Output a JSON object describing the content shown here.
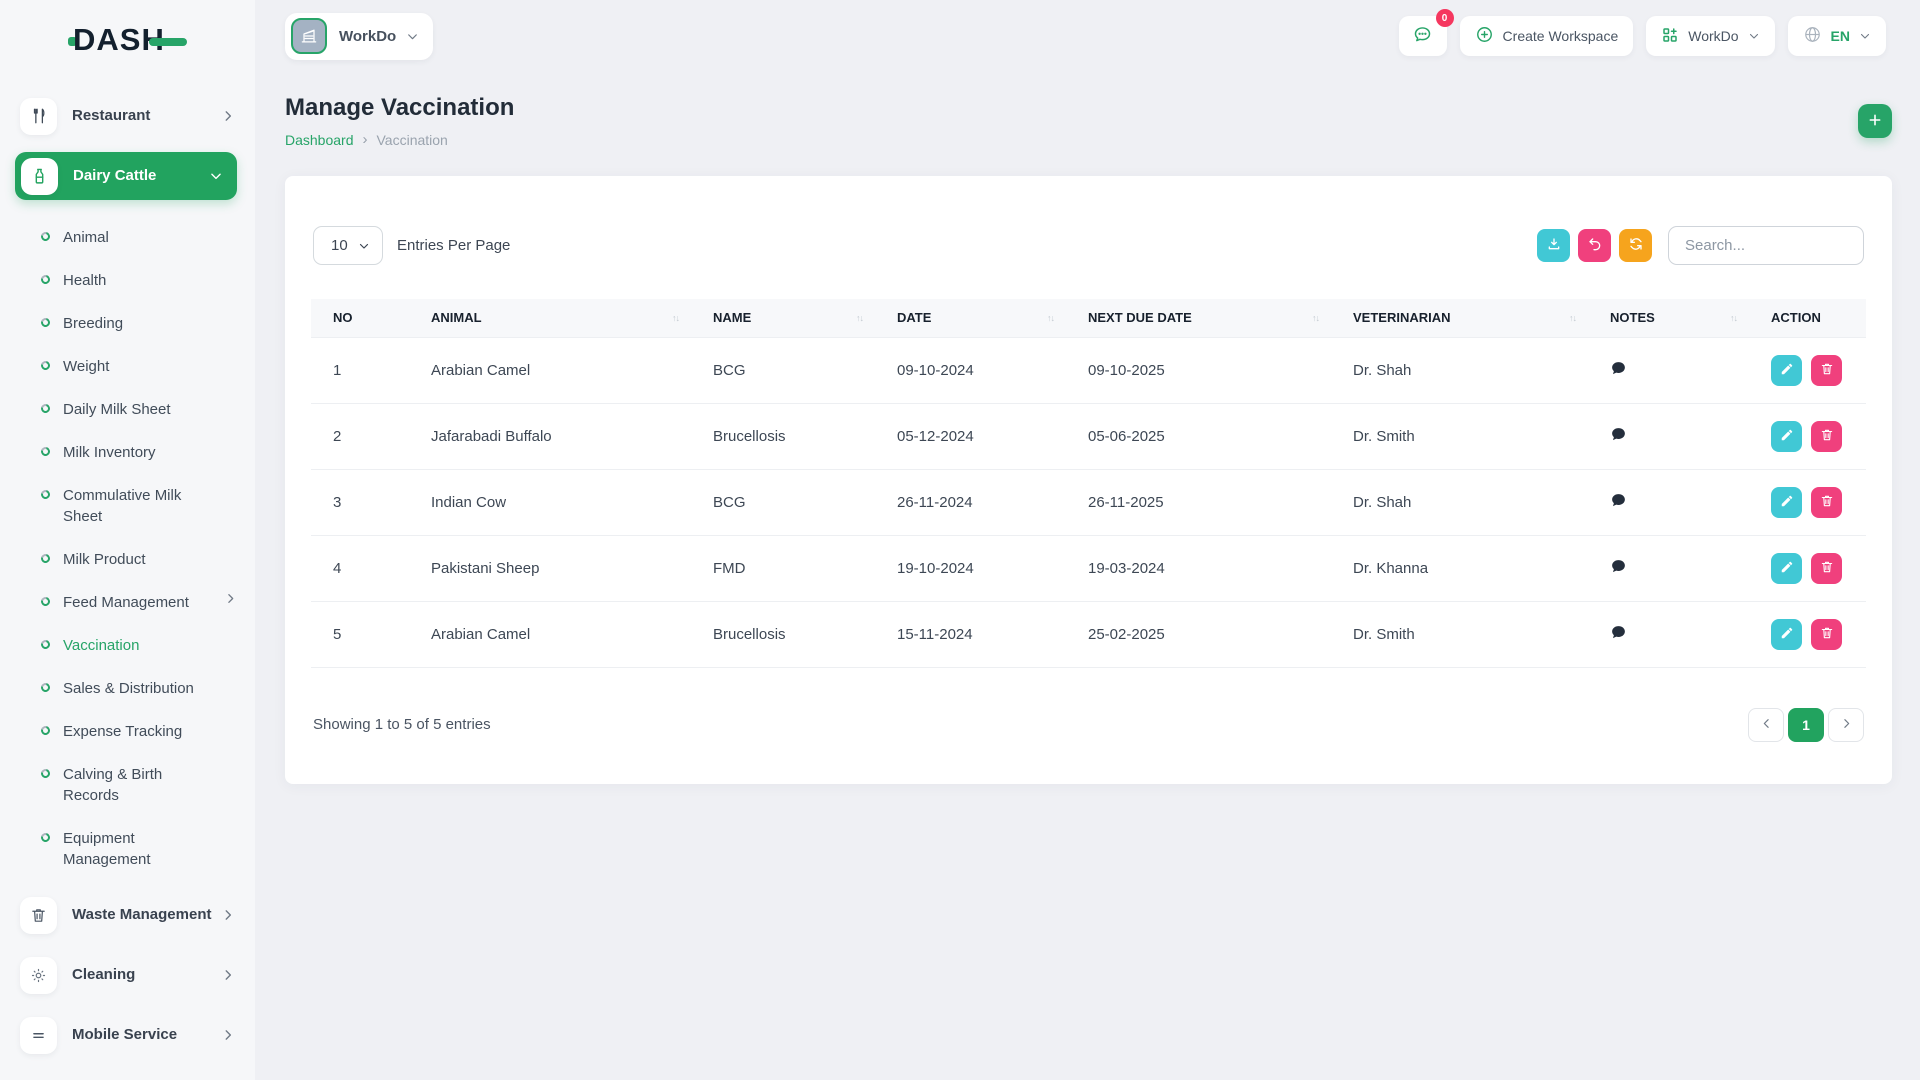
{
  "brand": {
    "logo_text": "DASH"
  },
  "topbar": {
    "workspace_selector_label": "WorkDo",
    "messages_badge": "0",
    "create_workspace_label": "Create Workspace",
    "workdo_menu_label": "WorkDo",
    "language_label": "EN"
  },
  "sidebar": {
    "restaurant": {
      "label": "Restaurant"
    },
    "dairy_cattle": {
      "label": "Dairy Cattle"
    },
    "dairy_items": [
      {
        "label": "Animal"
      },
      {
        "label": "Health"
      },
      {
        "label": "Breeding"
      },
      {
        "label": "Weight"
      },
      {
        "label": "Daily Milk Sheet"
      },
      {
        "label": "Milk Inventory"
      },
      {
        "label": "Commulative Milk Sheet"
      },
      {
        "label": "Milk Product"
      },
      {
        "label": "Feed Management"
      },
      {
        "label": "Vaccination",
        "active": true
      },
      {
        "label": "Sales & Distribution"
      },
      {
        "label": "Expense Tracking"
      },
      {
        "label": "Calving & Birth Records"
      },
      {
        "label": "Equipment Management"
      }
    ],
    "bottom_items": [
      {
        "label": "Waste Management"
      },
      {
        "label": "Cleaning"
      },
      {
        "label": "Mobile Service"
      }
    ]
  },
  "page": {
    "title": "Manage Vaccination",
    "breadcrumb": [
      "Dashboard",
      "Vaccination"
    ]
  },
  "controls": {
    "entries_value": "10",
    "entries_label": "Entries Per Page",
    "search_placeholder": "Search..."
  },
  "table": {
    "columns": [
      {
        "label": "NO",
        "sortable": false
      },
      {
        "label": "ANIMAL",
        "sortable": true
      },
      {
        "label": "NAME",
        "sortable": true
      },
      {
        "label": "DATE",
        "sortable": true
      },
      {
        "label": "NEXT DUE DATE",
        "sortable": true
      },
      {
        "label": "VETERINARIAN",
        "sortable": true
      },
      {
        "label": "NOTES",
        "sortable": true
      },
      {
        "label": "ACTION",
        "sortable": false
      }
    ],
    "rows": [
      {
        "no": "1",
        "animal": "Arabian Camel",
        "name": "BCG",
        "date": "09-10-2024",
        "next_due": "09-10-2025",
        "vet": "Dr. Shah"
      },
      {
        "no": "2",
        "animal": "Jafarabadi Buffalo",
        "name": "Brucellosis",
        "date": "05-12-2024",
        "next_due": "05-06-2025",
        "vet": "Dr. Smith"
      },
      {
        "no": "3",
        "animal": "Indian Cow",
        "name": "BCG",
        "date": "26-11-2024",
        "next_due": "26-11-2025",
        "vet": "Dr. Shah"
      },
      {
        "no": "4",
        "animal": "Pakistani Sheep",
        "name": "FMD",
        "date": "19-10-2024",
        "next_due": "19-03-2024",
        "vet": "Dr. Khanna"
      },
      {
        "no": "5",
        "animal": "Arabian Camel",
        "name": "Brucellosis",
        "date": "15-11-2024",
        "next_due": "25-02-2025",
        "vet": "Dr. Smith"
      }
    ],
    "footer": {
      "showing_text": "Showing 1 to 5 of 5 entries",
      "current_page": "1"
    }
  },
  "colors": {
    "primary_green": "#22a35f",
    "teal": "#41c8d5",
    "pink": "#f0407d",
    "orange": "#f6a41d",
    "badge_red": "#f5375f",
    "navy": "#222c38"
  }
}
